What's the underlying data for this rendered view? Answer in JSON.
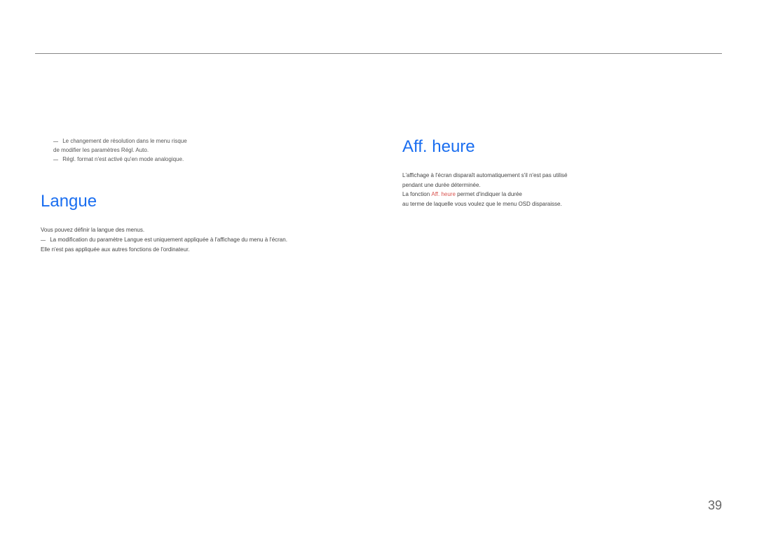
{
  "page": {
    "number": "39"
  },
  "left_column": {
    "note": {
      "line1": "Le changement de résolution dans le menu risque",
      "line2": "de modifier les paramètres Régl. Auto.",
      "line3": "Régl. format n'est activé qu'en mode analogique."
    },
    "heading": "Langue",
    "body": {
      "line1": "Vous pouvez définir la langue des menus.",
      "line2": "La modification du paramètre Langue est uniquement appliquée à l'affichage du menu à l'écran.",
      "line3": "Elle n'est pas appliquée aux autres fonctions de l'ordinateur."
    }
  },
  "right_column": {
    "heading": "Aff. heure",
    "body": {
      "line1": "L'affichage à l'écran disparaît automatiquement s'il n'est pas utilisé",
      "line2": "pendant une durée déterminée.",
      "line3_before": "La fonction ",
      "line3_accent": "Aff. heure",
      "line3_after": " permet d'indiquer la durée",
      "line4": "au terme de laquelle vous voulez que le menu OSD disparaisse."
    }
  }
}
